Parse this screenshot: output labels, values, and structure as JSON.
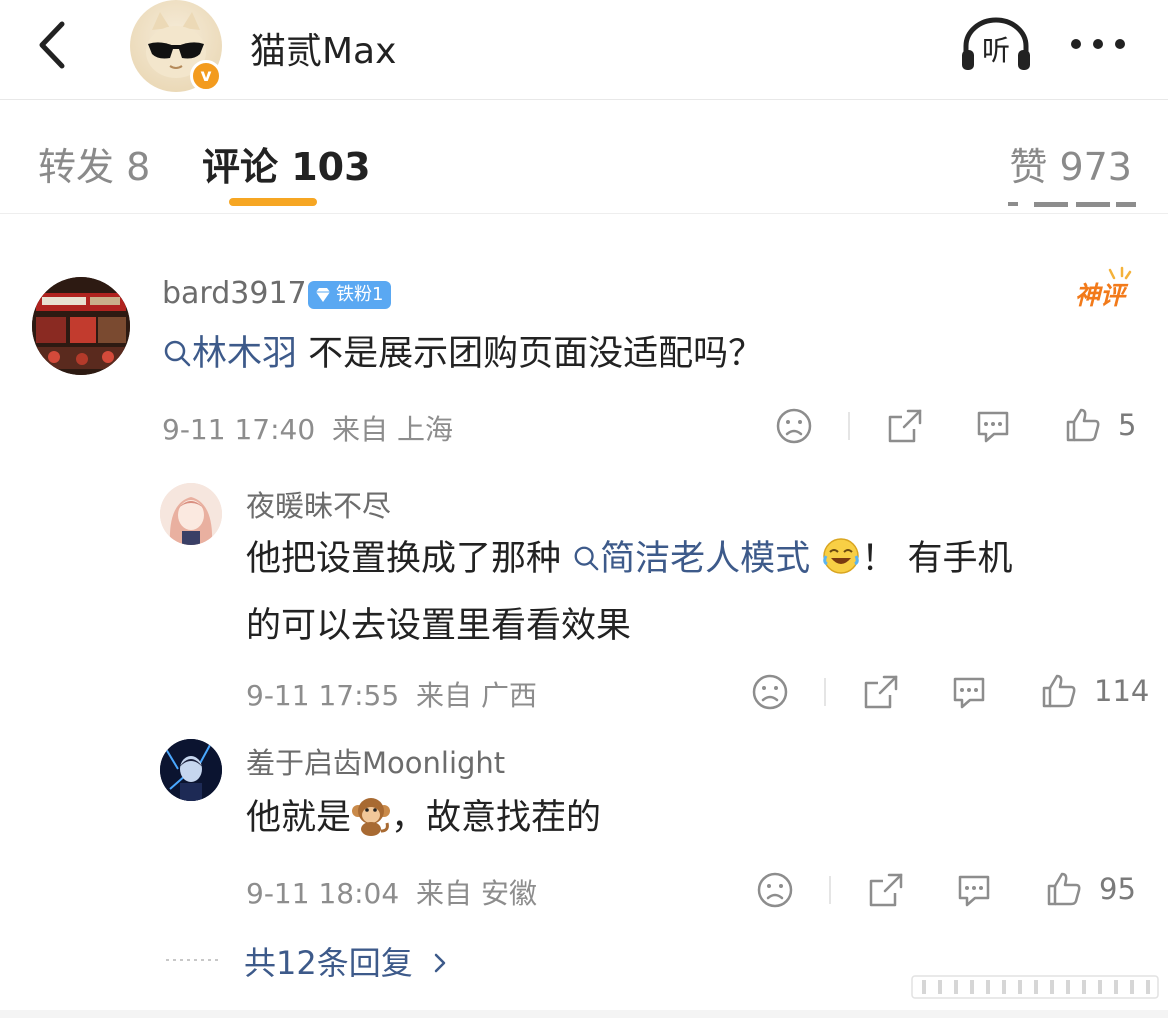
{
  "header": {
    "title": "猫贰Max",
    "verified_badge": "v",
    "listen_label": "听",
    "icons": [
      "back-arrow-icon",
      "headphones-icon",
      "more-icon"
    ]
  },
  "tabs": {
    "repost": "转发 8",
    "comments": "评论 103",
    "likes": "赞 973",
    "accent": "#f6a623"
  },
  "comment": {
    "user": "bard3917",
    "fan_badge": "铁粉1",
    "hot_badge": "神评",
    "mention": "林木羽",
    "text": " 不是展示团购页面没适配吗？",
    "time": "9-11 17:40",
    "location": "来自 上海",
    "likes": "5"
  },
  "replies": [
    {
      "user": "夜暖昧不尽",
      "text_before": "他把设置换成了那种",
      "link": "简洁老人模式",
      "text_after": "！ 有手机",
      "line2": "的可以去设置里看看效果",
      "time": "9-11 17:55",
      "location": "来自 广西",
      "likes": "114"
    },
    {
      "user": "羞于启齿Moonlight",
      "text_before": "他就是",
      "text_after": "，故意找茬的",
      "time": "9-11 18:04",
      "location": "来自 安徽",
      "likes": "95"
    }
  ],
  "more_replies": "共12条回复",
  "colors": {
    "link": "#3d5a8a",
    "fan_badge": "#5aa8f2",
    "hot": "#f27a1a",
    "verified": "#f39b1e"
  }
}
